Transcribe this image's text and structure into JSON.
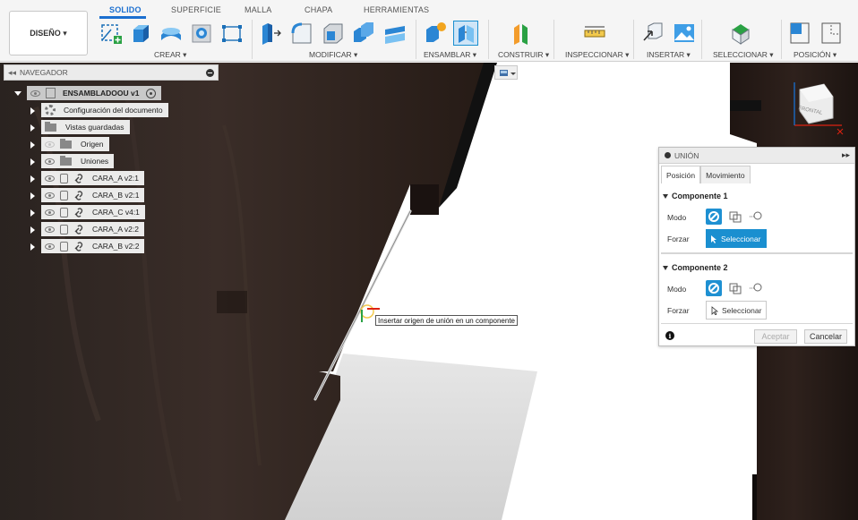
{
  "toolbar": {
    "workspace": "DISEÑO ▾",
    "tabs": [
      "SOLIDO",
      "SUPERFICIE",
      "MALLA",
      "CHAPA",
      "HERRAMIENTAS"
    ],
    "groups": [
      "CREAR ▾",
      "MODIFICAR ▾",
      "ENSAMBLAR ▾",
      "CONSTRUIR ▾",
      "INSPECCIONAR ▾",
      "INSERTAR ▾",
      "SELECCIONAR ▾",
      "POSICIÓN ▾"
    ]
  },
  "navigator": {
    "title": "NAVEGADOR",
    "root": "ENSAMBLADOOU v1",
    "items": [
      "Configuración del documento",
      "Vistas guardadas",
      "Origen",
      "Uniones",
      "CARA_A v2:1",
      "CARA_B v2:1",
      "CARA_C v4:1",
      "CARA_A v2:2",
      "CARA_B v2:2"
    ]
  },
  "joint_dialog": {
    "title": "UNIÓN",
    "tabs": [
      "Posición",
      "Movimiento"
    ],
    "component1": {
      "title": "Componente 1",
      "mode_label": "Modo",
      "force_label": "Forzar",
      "select_label": "Seleccionar"
    },
    "component2": {
      "title": "Componente 2",
      "mode_label": "Modo",
      "force_label": "Forzar",
      "select_label": "Seleccionar"
    },
    "ok_label": "Aceptar",
    "cancel_label": "Cancelar"
  },
  "tooltip": "Insertar origen de unión en un componente",
  "viewcube": {
    "label": "FRONTAL"
  },
  "colors": {
    "accent": "#1a8fd0",
    "tab_active": "#1b6fd0",
    "wood_dark": "#2a1c16"
  }
}
